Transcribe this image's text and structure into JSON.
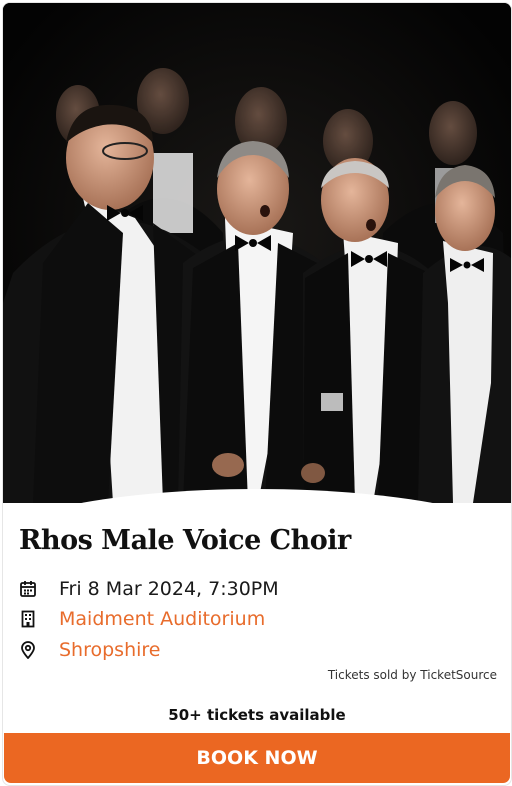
{
  "event": {
    "title": "Rhos Male Voice Choir",
    "datetime": "Fri 8 Mar 2024, 7:30PM",
    "venue": "Maidment Auditorium",
    "location": "Shropshire"
  },
  "seller_note": "Tickets sold by TicketSource",
  "availability": "50+ tickets available",
  "book_label": "BOOK NOW",
  "colors": {
    "accent": "#eb6722",
    "link": "#e86c2c",
    "text": "#1a1a1a"
  },
  "icons": {
    "date": "calendar-icon",
    "venue": "building-icon",
    "location": "map-pin-icon"
  }
}
